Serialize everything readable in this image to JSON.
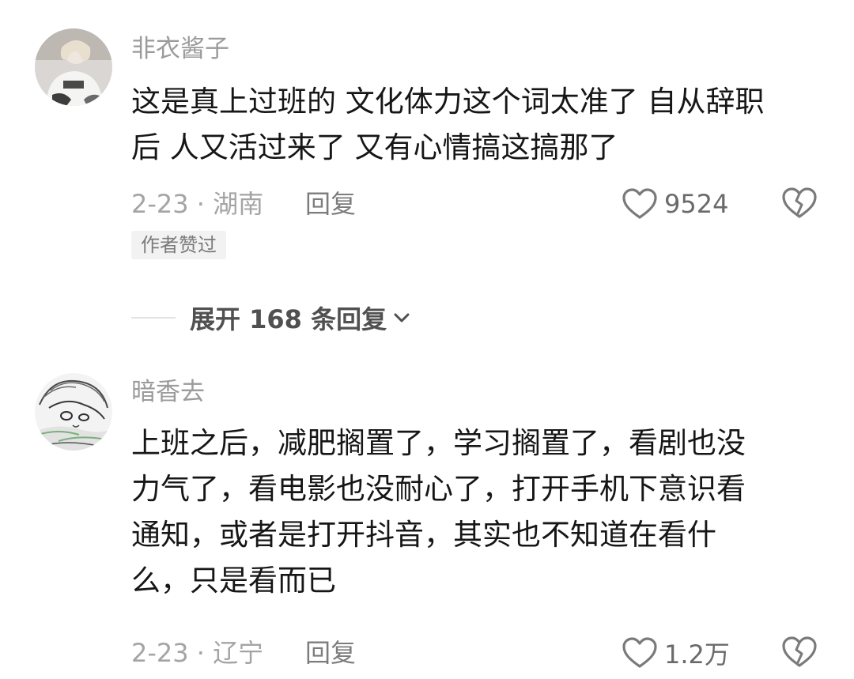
{
  "comments": [
    {
      "username": "非衣酱子",
      "text_lines": [
        "这是真上过班的 文化体力这个词太准了 自从辞职",
        "后 人又活过来了 又有心情搞这搞那了"
      ],
      "date_location": "2-23 · 湖南",
      "reply_label": "回复",
      "like_count": "9524",
      "badge": "作者赞过",
      "avatar_icon": "user-avatar-photo",
      "like_icon": "heart-outline-icon",
      "dislike_icon": "broken-heart-icon"
    },
    {
      "username": "暗香去",
      "text_lines": [
        "上班之后，减肥搁置了，学习搁置了，看剧也没",
        "力气了，看电影也没耐心了，打开手机下意识看",
        "通知，或者是打开抖音，其实也不知道在看什",
        "么，只是看而已"
      ],
      "date_location": "2-23 · 辽宁",
      "reply_label": "回复",
      "like_count": "1.2万",
      "avatar_icon": "manga-avatar-illustration",
      "like_icon": "heart-outline-icon",
      "dislike_icon": "broken-heart-icon"
    }
  ],
  "expand_replies": {
    "label": "展开 168 条回复",
    "icon": "chevron-down-icon"
  },
  "colors": {
    "username": "#9b9b9b",
    "text": "#161616",
    "meta": "#a4a4a4",
    "badge_bg": "#f2f2f2",
    "icon_stroke": "#7a7a7a"
  }
}
